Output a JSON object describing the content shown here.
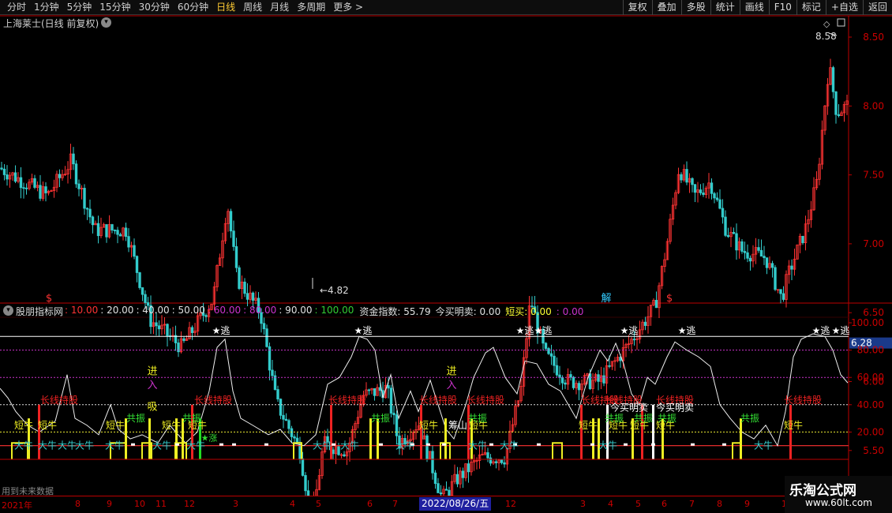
{
  "toolbar": {
    "periods": [
      "分时",
      "1分钟",
      "5分钟",
      "15分钟",
      "30分钟",
      "60分钟",
      "日线",
      "周线",
      "月线",
      "多周期",
      "更多 >"
    ],
    "active_period": "日线",
    "actions": [
      "复权",
      "叠加",
      "多股",
      "统计",
      "画线",
      "F10",
      "标记",
      "+自选",
      "返回"
    ]
  },
  "main_chart": {
    "title": "上海莱士(日线 前复权)",
    "price_ticks": [
      "8.50",
      "8.00",
      "7.50",
      "7.00",
      "6.50",
      "6.00",
      "5.50",
      "5.00"
    ],
    "current_price": "6.28",
    "high_label": "8.58",
    "low_label": "4.82",
    "markers": [
      {
        "text": "$",
        "color": "#ff3333"
      },
      {
        "text": "解",
        "color": "#33ccff"
      },
      {
        "text": "$",
        "color": "#ff3333"
      }
    ],
    "colors": {
      "up": "#ff3333",
      "down": "#33cccc",
      "price_tag": "#1a3a8a"
    }
  },
  "indicator": {
    "name": "股朋指标网",
    "levels": [
      {
        "text": ": 10.00",
        "color": "#ff3333"
      },
      {
        "text": ": 20.00",
        "color": "#e0e0e0"
      },
      {
        "text": ": 40.00",
        "color": "#e0e0e0"
      },
      {
        "text": ": 50.00",
        "color": "#e0e0e0"
      },
      {
        "text": ": 60.00",
        "color": "#cc33cc"
      },
      {
        "text": ": 80.00",
        "color": "#cc33cc"
      },
      {
        "text": ": 90.00",
        "color": "#e0e0e0"
      },
      {
        "text": ": 100.00",
        "color": "#33cc33"
      }
    ],
    "metrics": [
      {
        "text": "资金指数: 55.79",
        "color": "#e0e0e0"
      },
      {
        "text": "今买明卖: 0.00",
        "color": "#e0e0e0"
      },
      {
        "text": "短买: 0.00",
        "color": "#ffff33"
      },
      {
        "text": ": 0.00",
        "color": "#cc33cc"
      }
    ],
    "axis_ticks": [
      "100.00",
      "80.00",
      "60.00",
      "40.00",
      "20.00"
    ],
    "labels": {
      "escape": "★逃",
      "long_hold": "长线持股",
      "short_bull": "短牛",
      "big_bull": "大牛",
      "resonance": "共振",
      "enter": "进",
      "enter2": "入",
      "absorb": "吸",
      "buy_today_sell": "今买明卖",
      "chip": "筹山",
      "rise": "★涨"
    },
    "volume_label": "用到未来数据"
  },
  "date_axis": {
    "labels": [
      "2021年",
      "8",
      "9",
      "10",
      "11",
      "12",
      "3",
      "4",
      "5",
      "6",
      "7",
      "12",
      "3",
      "4",
      "5",
      "6",
      "7",
      "8",
      "9",
      "1"
    ],
    "cursor_date": "2022/08/26/五"
  },
  "watermark": {
    "title": "乐淘公式网",
    "url": "www.60lt.com"
  }
}
